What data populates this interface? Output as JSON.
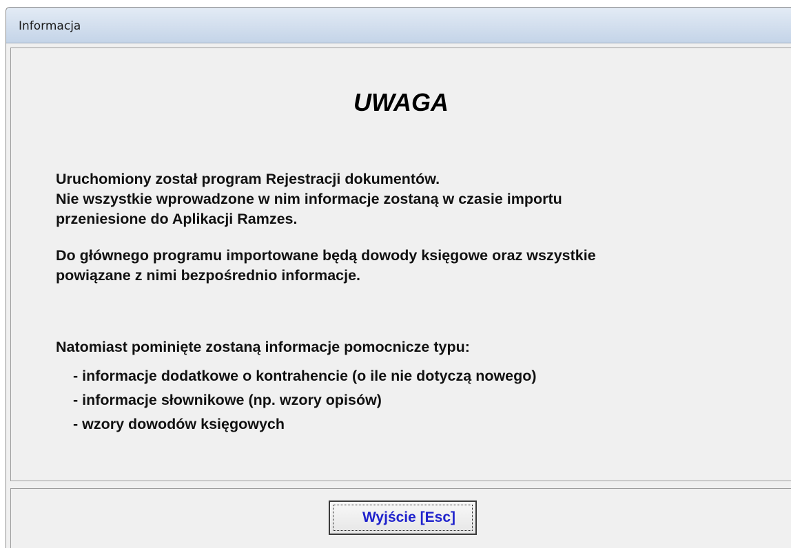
{
  "window": {
    "title": "Informacja"
  },
  "notice": {
    "heading": "UWAGA",
    "paragraph1": [
      "Uruchomiony został program Rejestracji dokumentów.",
      "Nie wszystkie wprowadzone w nim informacje zostaną w czasie importu",
      "przeniesione do Aplikacji Ramzes."
    ],
    "paragraph2": [
      "Do głównego programu importowane będą dowody księgowe oraz wszystkie",
      "powiązane z nimi bezpośrednio informacje."
    ],
    "paragraph3": "Natomiast pominięte zostaną informacje pomocnicze typu:",
    "items": [
      "- informacje dodatkowe o kontrahencie (o ile nie dotyczą nowego)",
      "- informacje słownikowe (np. wzory opisów)",
      "- wzory dowodów księgowych"
    ]
  },
  "buttons": {
    "exit_label": "Wyjście  [Esc]"
  },
  "colors": {
    "button_text": "#1f22cc",
    "titlebar": "#c4d4e8",
    "background": "#f0f0f0"
  }
}
